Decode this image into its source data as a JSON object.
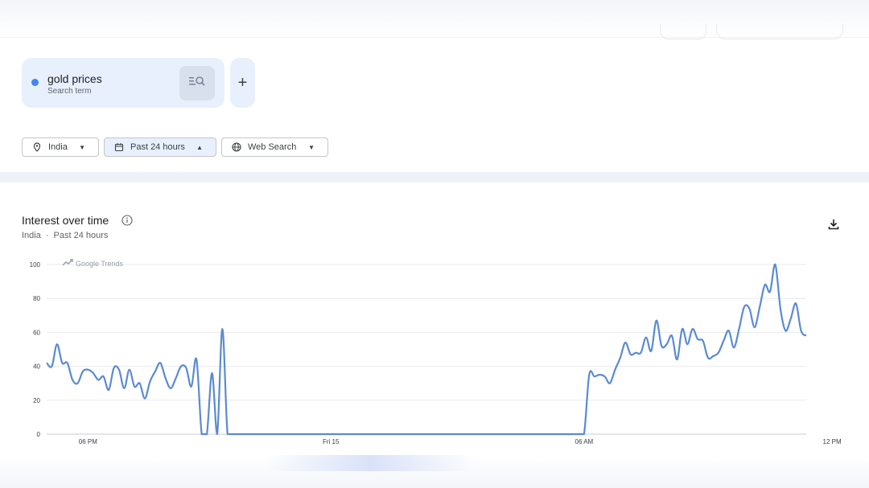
{
  "search_term": {
    "name": "gold prices",
    "type_label": "Search term",
    "color": "#4285f4",
    "add_label": "+"
  },
  "filters": {
    "location": "India",
    "time_range": "Past 24 hours",
    "search_type": "Web Search"
  },
  "widget": {
    "title": "Interest over time",
    "subtitle_location": "India",
    "subtitle_separator": "·",
    "subtitle_range": "Past 24 hours",
    "brand": "Google Trends"
  },
  "chart_data": {
    "type": "line",
    "title": "Interest over time",
    "xlabel": "",
    "ylabel": "",
    "ylim": [
      0,
      100
    ],
    "y_ticks": [
      0,
      20,
      40,
      60,
      80,
      100
    ],
    "x_tick_labels": [
      {
        "label": "06 PM",
        "index": 8
      },
      {
        "label": "Fri 15",
        "index": 55
      },
      {
        "label": "06 AM",
        "index": 104
      },
      {
        "label": "12 PM",
        "index": 152
      }
    ],
    "grid": true,
    "color": "#5b8ad1",
    "series": [
      {
        "values": [
          42,
          40,
          53,
          42,
          42,
          32,
          30,
          37,
          38,
          36,
          32,
          34,
          26,
          39,
          38,
          27,
          38,
          28,
          30,
          21,
          31,
          37,
          42,
          33,
          27,
          33,
          40,
          39,
          28,
          44,
          0,
          0,
          36,
          0,
          62,
          0,
          0,
          0,
          0,
          0,
          0,
          0,
          0,
          0,
          0,
          0,
          0,
          0,
          0,
          0,
          0,
          0,
          0,
          0,
          0,
          0,
          0,
          0,
          0,
          0,
          0,
          0,
          0,
          0,
          0,
          0,
          0,
          0,
          0,
          0,
          0,
          0,
          0,
          0,
          0,
          0,
          0,
          0,
          0,
          0,
          0,
          0,
          0,
          0,
          0,
          0,
          0,
          0,
          0,
          0,
          0,
          0,
          0,
          0,
          0,
          0,
          0,
          0,
          0,
          0,
          0,
          0,
          0,
          0,
          0,
          35,
          34,
          35,
          34,
          30,
          38,
          45,
          54,
          47,
          48,
          48,
          57,
          49,
          67,
          52,
          53,
          58,
          44,
          62,
          53,
          62,
          56,
          55,
          45,
          46,
          48,
          55,
          61,
          51,
          62,
          75,
          74,
          63,
          75,
          88,
          84,
          100,
          74,
          61,
          68,
          77,
          61,
          58
        ]
      }
    ]
  }
}
